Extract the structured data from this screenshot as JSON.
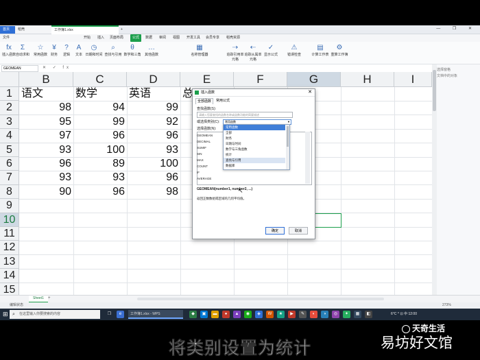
{
  "window": {
    "tabs": [
      "首页",
      "稻壳",
      "工作簿1.xlsx"
    ],
    "new_tab": "+",
    "window_controls": "— ❐ ✕"
  },
  "menu": [
    "文件",
    "开始",
    "插入",
    "页面布局",
    "公式",
    "数据",
    "审阅",
    "视图",
    "开发工具",
    "会员专享",
    "稻壳资源"
  ],
  "menu_active": "公式",
  "ribbon": [
    {
      "icon": "fx",
      "label": "插入函数"
    },
    {
      "icon": "Σ",
      "label": "自动求和"
    },
    {
      "icon": "☆",
      "label": "常用函数"
    },
    {
      "icon": "¥",
      "label": "财务"
    },
    {
      "icon": "?",
      "label": "逻辑"
    },
    {
      "icon": "A",
      "label": "文本"
    },
    {
      "icon": "◷",
      "label": "日期和时间"
    },
    {
      "icon": "⌕",
      "label": "查找与引用"
    },
    {
      "icon": "θ",
      "label": "数学和三角"
    },
    {
      "icon": "…",
      "label": "其他函数"
    },
    {
      "icon": "▦",
      "label": "名称管理器"
    },
    {
      "icon": "⇢",
      "label": "追踪引用单元格"
    },
    {
      "icon": "⇠",
      "label": "追踪从属单元格"
    },
    {
      "icon": "✓",
      "label": "显示公式"
    },
    {
      "icon": "⚠",
      "label": "错误检查"
    },
    {
      "icon": "▤",
      "label": "计算工作表"
    },
    {
      "icon": "⚙",
      "label": "重算工作簿"
    }
  ],
  "formula_bar": {
    "name_box": "GEOMEAN",
    "controls": "✕ ✓ fx"
  },
  "grid": {
    "columns": [
      "B",
      "C",
      "D",
      "E",
      "F",
      "G",
      "H",
      "I"
    ],
    "selected_column": "G",
    "rows": [
      "1",
      "2",
      "3",
      "4",
      "5",
      "6",
      "7",
      "8",
      "9",
      "10",
      "11",
      "12",
      "13",
      "14",
      "15"
    ],
    "selected_row": "10",
    "headers": [
      "语文",
      "数学",
      "英语",
      "总"
    ],
    "values": [
      [
        "98",
        "94",
        "99"
      ],
      [
        "95",
        "99",
        "92"
      ],
      [
        "97",
        "96",
        "96"
      ],
      [
        "93",
        "100",
        "93"
      ],
      [
        "96",
        "89",
        "100"
      ],
      [
        "93",
        "93",
        "96"
      ],
      [
        "90",
        "96",
        "98"
      ]
    ]
  },
  "right_panel": {
    "line1": "选择窗格",
    "line2": "文档中的对象"
  },
  "sheet": {
    "tab": "Sheet1",
    "add": "+"
  },
  "status": {
    "left": "编辑状态",
    "zoom": "273%"
  },
  "dialog": {
    "title": "插入函数",
    "tabs": [
      "全部函数",
      "常用公式"
    ],
    "search_label": "查找函数(S):",
    "search_placeholder": "请输入您要查找的函数名称或函数功能的简要描述",
    "category_label": "或选择类别(C):",
    "category_value": "常用函数",
    "select_label": "选择函数(N):",
    "category_options": [
      "常用函数",
      "全部",
      "财务",
      "日期与时间",
      "数学与三角函数",
      "统计",
      "查找与引用",
      "数据库"
    ],
    "category_highlighted": "查找与引用",
    "functions": [
      "GEOMEAN",
      "DECIMAL",
      "SUMIF",
      "SIN",
      "MAX",
      "COUNT",
      "IF",
      "AVERAGE"
    ],
    "signature": "GEOMEAN(number1, number2, ...)",
    "description": "返回正数数组或区域的几何平均值。",
    "ok": "确定",
    "cancel": "取消"
  },
  "taskbar": {
    "search_placeholder": "在这里输入你要搜索的内容",
    "active_app": "工作簿1.xlsx - WPS",
    "tray": "6°C  ^  ⊡  中  12:00"
  },
  "overlay": {
    "subtitle": "将类别设置为统计",
    "watermark_top": "天奇生活",
    "watermark_bottom": "易坊好文馆"
  }
}
